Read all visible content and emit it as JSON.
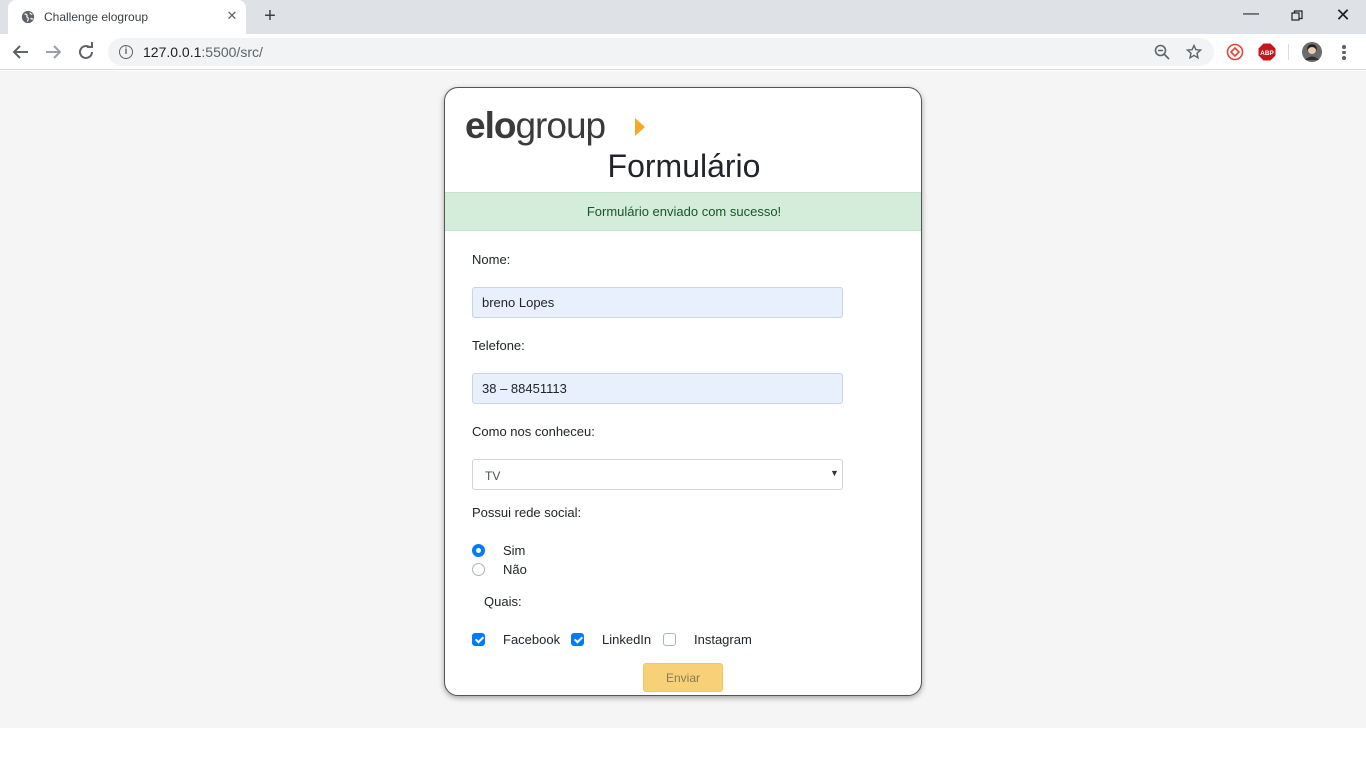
{
  "browser": {
    "tab_title": "Challenge elogroup",
    "new_tab_symbol": "+",
    "url_host": "127.0.0.1",
    "url_rest": ":5500/src/"
  },
  "page": {
    "logo": {
      "light": "elo",
      "bold_part": "",
      "rest": "group"
    },
    "title": "Formulário",
    "alert": "Formulário enviado com sucesso!",
    "fields": {
      "name_label": "Nome:",
      "name_value": "breno Lopes",
      "phone_label": "Telefone:",
      "phone_value": "38 – 88451113",
      "source_label": "Como nos conheceu:",
      "source_value": "TV",
      "social_label": "Possui rede social:",
      "social_yes": "Sim",
      "social_no": "Não",
      "social_selected": "Sim",
      "which_label": "Quais:",
      "networks": [
        {
          "label": "Facebook",
          "checked": true
        },
        {
          "label": "LinkedIn",
          "checked": true
        },
        {
          "label": "Instagram",
          "checked": false
        }
      ]
    },
    "submit_label": "Enviar"
  },
  "colors": {
    "accent": "#f7a826",
    "alert_bg": "#d4edda",
    "alert_text": "#155724",
    "control_blue": "#007bff",
    "button_bg": "#f7d078"
  },
  "icons": {
    "tab_favicon": "globe-icon",
    "back": "arrow-left-icon",
    "forward": "arrow-right-icon",
    "reload": "reload-icon",
    "info": "info-icon",
    "zoom": "zoom-out-icon",
    "bookmark": "star-icon",
    "menu": "kebab-menu-icon"
  }
}
